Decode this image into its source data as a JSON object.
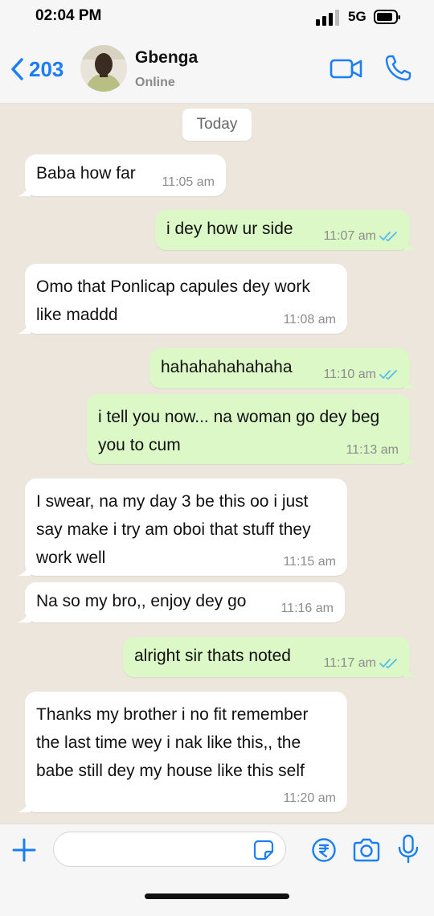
{
  "status_bar": {
    "time": "02:04 PM",
    "network": "5G"
  },
  "header": {
    "back_count": "203",
    "contact_name": "Gbenga",
    "contact_status": "Online"
  },
  "chat": {
    "date_label": "Today",
    "messages": [
      {
        "direction": "in",
        "text": "Baba how far",
        "time": "11:05 am"
      },
      {
        "direction": "out",
        "text": "i dey how ur side",
        "time": "11:07 am",
        "read": true
      },
      {
        "direction": "in",
        "text": "Omo that Ponlicap capules dey work like maddd",
        "time": "11:08 am"
      },
      {
        "direction": "out",
        "text": "hahahahahahaha",
        "time": "11:10 am",
        "read": true
      },
      {
        "direction": "out",
        "text": "i tell you now... na woman go dey beg you to cum",
        "time": "11:13 am"
      },
      {
        "direction": "in",
        "text": "I swear, na my day 3 be this oo i just say make i try am oboi that stuff they work well",
        "time": "11:15 am"
      },
      {
        "direction": "in",
        "text": "Na so my bro,, enjoy dey go",
        "time": "11:16 am"
      },
      {
        "direction": "out",
        "text": "alright sir thats noted",
        "time": "11:17 am",
        "read": true
      },
      {
        "direction": "in",
        "text": "Thanks my brother i no fit remember the last time wey i nak like this,, the babe still dey my house like this self",
        "time": "11:20 am"
      }
    ]
  },
  "input": {
    "placeholder": ""
  },
  "colors": {
    "accent": "#1a7ef5",
    "outgoing_bubble": "#dcf8c6",
    "incoming_bubble": "#ffffff",
    "read_tick": "#53bdeb"
  },
  "icons": [
    "back-chevron-icon",
    "video-camera-icon",
    "phone-icon",
    "plus-icon",
    "sticker-icon",
    "rupee-icon",
    "camera-icon",
    "microphone-icon",
    "read-receipt-icon"
  ]
}
